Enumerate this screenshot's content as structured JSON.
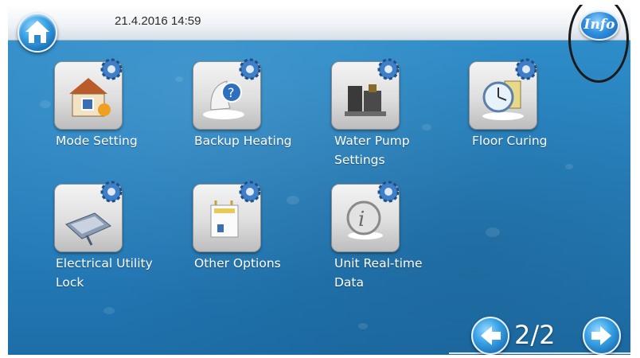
{
  "header": {
    "datetime": "21.4.2016 14:59",
    "home_icon": "home-icon",
    "info_label": "Info"
  },
  "menu": {
    "items": [
      {
        "label_line1": "Mode Setting",
        "label_line2": "",
        "icon": "mode-setting-icon"
      },
      {
        "label_line1": "Backup Heating",
        "label_line2": "",
        "icon": "backup-heating-icon"
      },
      {
        "label_line1": "Water Pump",
        "label_line2": "Settings",
        "icon": "water-pump-icon"
      },
      {
        "label_line1": "Floor Curing",
        "label_line2": "",
        "icon": "floor-curing-icon"
      },
      {
        "label_line1": "Electrical Utility",
        "label_line2": "Lock",
        "icon": "electrical-utility-lock-icon"
      },
      {
        "label_line1": "Other Options",
        "label_line2": "",
        "icon": "other-options-icon"
      },
      {
        "label_line1": "Unit Real-time",
        "label_line2": "Data",
        "icon": "unit-realtime-data-icon"
      }
    ]
  },
  "pagination": {
    "current": 2,
    "total": 2,
    "text": "2/2",
    "prev_icon": "arrow-left-icon",
    "next_icon": "arrow-right-icon"
  },
  "colors": {
    "background": "#2a86c3",
    "topbar": "#eef2f6",
    "button_blue": "#1b6fb6",
    "label_text": "#ffffff"
  }
}
